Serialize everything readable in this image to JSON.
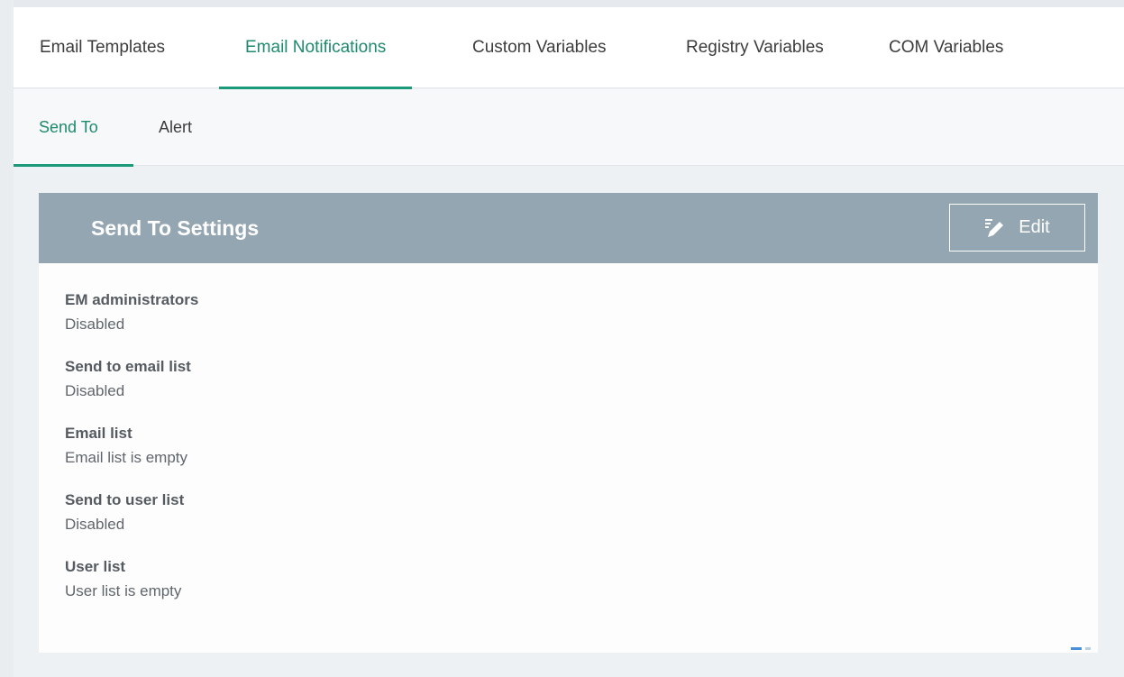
{
  "tabs": [
    {
      "label": "Email Templates",
      "active": false
    },
    {
      "label": "Email Notifications",
      "active": true
    },
    {
      "label": "Custom Variables",
      "active": false
    },
    {
      "label": "Registry Variables",
      "active": false
    },
    {
      "label": "COM Variables",
      "active": false
    }
  ],
  "subtabs": [
    {
      "label": "Send To",
      "active": true
    },
    {
      "label": "Alert",
      "active": false
    }
  ],
  "panel": {
    "title": "Send To Settings",
    "edit_label": "Edit",
    "edit_icon": "edit-pencil-icon"
  },
  "fields": [
    {
      "label": "EM administrators",
      "value": "Disabled"
    },
    {
      "label": "Send to email list",
      "value": "Disabled"
    },
    {
      "label": "Email list",
      "value": "Email list is empty"
    },
    {
      "label": "Send to user list",
      "value": "Disabled"
    },
    {
      "label": "User list",
      "value": "User list is empty"
    }
  ],
  "colors": {
    "accent": "#1a9a78",
    "panel_header": "#95a6b3",
    "background": "#eef1f4"
  }
}
